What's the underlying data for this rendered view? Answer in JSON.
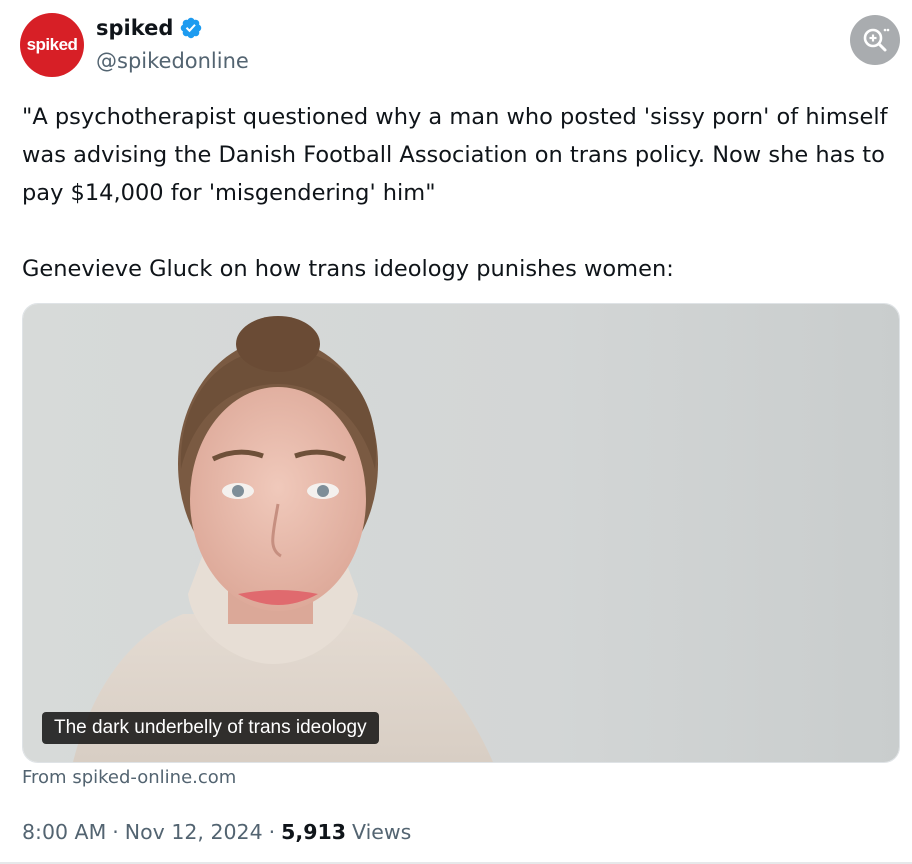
{
  "author": {
    "avatar_text": "spiked",
    "display_name": "spiked",
    "handle": "@spikedonline",
    "verified_color": "#1d9bf0",
    "avatar_color": "#d71f26"
  },
  "tweet": {
    "paragraph_1": "\"A psychotherapist questioned why a man who posted 'sissy porn' of himself was advising the Danish Football Association on trans policy. Now she has to pay $14,000 for 'misgendering' him\"",
    "paragraph_2": "Genevieve Gluck on how trans ideology punishes women:"
  },
  "card": {
    "title": "The dark underbelly of trans ideology",
    "source": "From spiked-online.com"
  },
  "meta": {
    "time": "8:00 AM",
    "separator": "·",
    "date": "Nov 12, 2024",
    "views_count": "5,913",
    "views_label": "Views"
  },
  "icons": {
    "zoom": "zoom-in-icon",
    "verified": "verified-badge-icon"
  }
}
